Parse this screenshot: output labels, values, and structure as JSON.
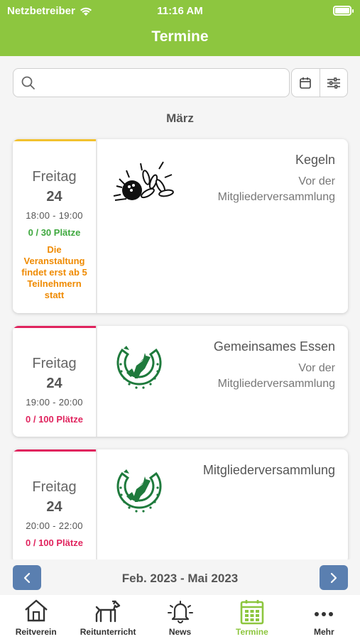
{
  "status_bar": {
    "carrier": "Netzbetreiber",
    "time": "11:16 AM"
  },
  "header": {
    "title": "Termine"
  },
  "search": {
    "placeholder": "",
    "value": ""
  },
  "month_label": "März",
  "events": [
    {
      "day_name": "Freitag",
      "day_num": "24",
      "time": "18:00 - 19:00",
      "places": "0 / 30 Plätze",
      "places_color": "#3ea83e",
      "accent": "#f2c12e",
      "warning": "Die Veranstaltung findet erst ab 5 Teilnehmern statt",
      "title": "Kegeln",
      "subtitle_1": "Vor der",
      "subtitle_2": "Mitgliederversammlung",
      "image": "bowling-icon"
    },
    {
      "day_name": "Freitag",
      "day_num": "24",
      "time": "19:00 - 20:00",
      "places": "0 / 100 Plätze",
      "places_color": "#e0245e",
      "accent": "#e0245e",
      "title": "Gemeinsames Essen",
      "subtitle_1": "Vor der",
      "subtitle_2": "Mitgliederversammlung",
      "image": "club-logo"
    },
    {
      "day_name": "Freitag",
      "day_num": "24",
      "time": "20:00 - 22:00",
      "places": "0 / 100 Plätze",
      "places_color": "#e0245e",
      "accent": "#e0245e",
      "title": "Mitgliederversammlung",
      "image": "club-logo"
    }
  ],
  "pager": {
    "range": "Feb. 2023 - Mai 2023"
  },
  "tabs": [
    {
      "label": "Reitverein",
      "icon": "house-icon"
    },
    {
      "label": "Reitunterricht",
      "icon": "horse-icon"
    },
    {
      "label": "News",
      "icon": "bell-icon"
    },
    {
      "label": "Termine",
      "icon": "calendar-icon",
      "active": true
    },
    {
      "label": "Mehr",
      "icon": "more-icon"
    }
  ],
  "colors": {
    "brand": "#8dc63f",
    "button": "#5a7fb0",
    "warning": "#ef8a00",
    "club_green": "#1e7a3c"
  }
}
